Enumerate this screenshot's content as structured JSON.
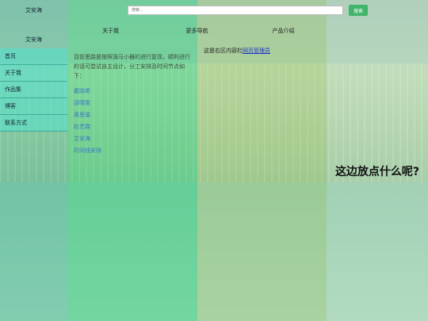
{
  "header": {
    "logo": "艾安海",
    "search": {
      "placeholder": "搜索...",
      "button": "搜索"
    }
  },
  "nav": {
    "items": [
      "关于我",
      "更多导航",
      "产品介绍"
    ]
  },
  "sidebar": {
    "logo": "艾安海",
    "items": [
      "首页",
      "关于我",
      "作品集",
      "博客",
      "联系方式"
    ]
  },
  "main": {
    "intro": "目前思路是按照淄马小器的进行复现，顺利进行的话可尝试自主设计，分工安排及时间节点如下：",
    "list": [
      "戴晓希",
      "邵晴雯",
      "黄思骏",
      "赵艺霖",
      "艾安海",
      "时间线安排"
    ]
  },
  "right": {
    "text": "这是右区内容栏",
    "link": "网页管理员"
  },
  "aside": {
    "big_text": "这边放点什么呢?"
  }
}
